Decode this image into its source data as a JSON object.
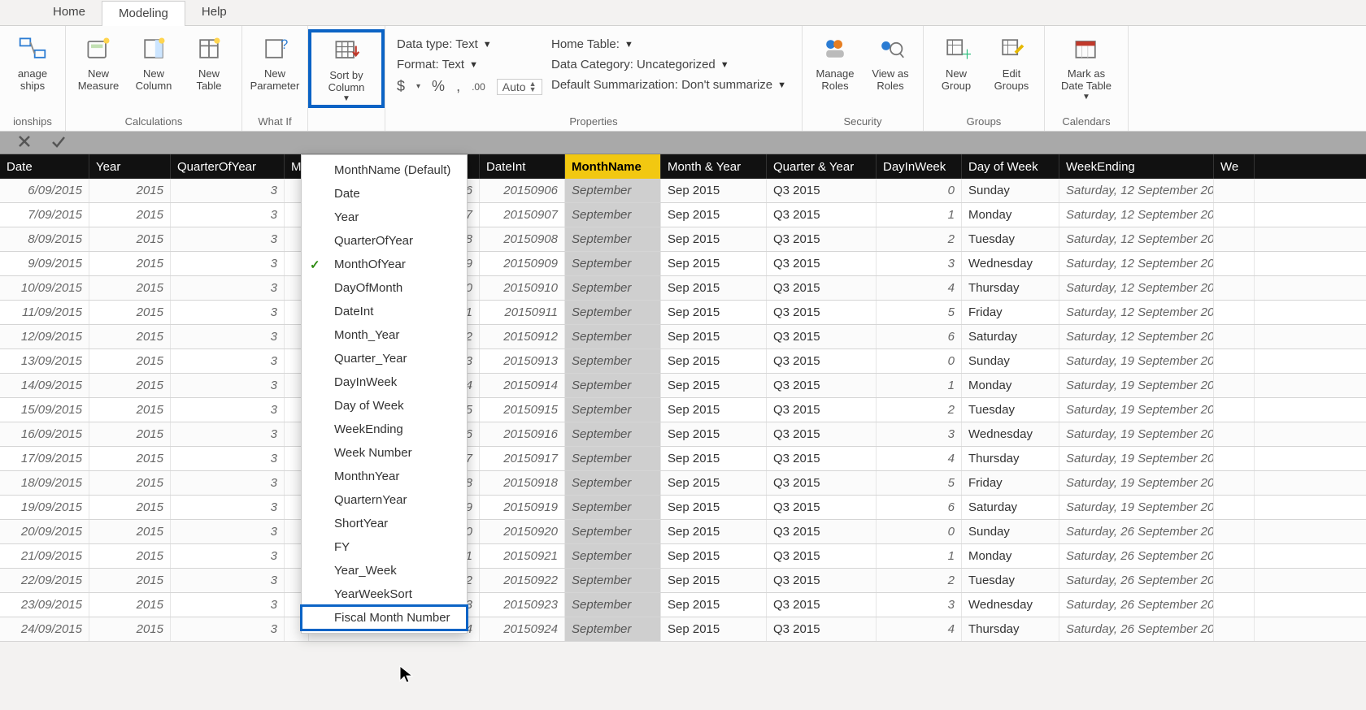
{
  "tabs": {
    "home": "Home",
    "modeling": "Modeling",
    "help": "Help"
  },
  "ribbon": {
    "manage_relationships": "anage\nships",
    "new_measure": "New\nMeasure",
    "new_column": "New\nColumn",
    "new_table": "New\nTable",
    "new_parameter": "New\nParameter",
    "sort_by_column": "Sort by\nColumn",
    "manage_roles": "Manage\nRoles",
    "view_as_roles": "View as\nRoles",
    "new_group": "New\nGroup",
    "edit_groups": "Edit\nGroups",
    "mark_as_date_table": "Mark as\nDate Table",
    "groups": {
      "relationships": "ionships",
      "calculations": "Calculations",
      "whatif": "What If",
      "sort": "",
      "properties": "Properties",
      "security": "Security",
      "groups_lbl": "Groups",
      "calendars": "Calendars"
    },
    "props": {
      "data_type": "Data type: Text",
      "home_table": "Home Table:",
      "format": "Format: Text",
      "data_category": "Data Category: Uncategorized",
      "default_summarization": "Default Summarization: Don't summarize",
      "dollar": "$",
      "percent": "%",
      "comma": ",",
      "decimals": ".00",
      "auto": "Auto"
    }
  },
  "dropdown": {
    "items": [
      {
        "label": "MonthName (Default)"
      },
      {
        "label": "Date"
      },
      {
        "label": "Year"
      },
      {
        "label": "QuarterOfYear"
      },
      {
        "label": "MonthOfYear",
        "checked": true
      },
      {
        "label": "DayOfMonth"
      },
      {
        "label": "DateInt"
      },
      {
        "label": "Month_Year"
      },
      {
        "label": "Quarter_Year"
      },
      {
        "label": "DayInWeek"
      },
      {
        "label": "Day of Week"
      },
      {
        "label": "WeekEnding"
      },
      {
        "label": "Week Number"
      },
      {
        "label": "MonthnYear"
      },
      {
        "label": "QuarternYear"
      },
      {
        "label": "ShortYear"
      },
      {
        "label": "FY"
      },
      {
        "label": "Year_Week"
      },
      {
        "label": "YearWeekSort"
      },
      {
        "label": "Fiscal Month Number",
        "highlight": true
      }
    ]
  },
  "grid": {
    "headers": {
      "date": "Date",
      "year": "Year",
      "qoy": "QuarterOfYear",
      "moy": "M",
      "hidden": "",
      "dateint": "DateInt",
      "monthname": "MonthName",
      "monthyear": "Month & Year",
      "quarteryear": "Quarter & Year",
      "dayinweek": "DayInWeek",
      "dayofweek": "Day of Week",
      "weekending": "WeekEnding",
      "wk": "We"
    },
    "rows": [
      {
        "date": "6/09/2015",
        "year": "2015",
        "qoy": "3",
        "pk": "6",
        "dateint": "20150906",
        "mname": "September",
        "my": "Sep 2015",
        "qy": "Q3 2015",
        "diw": "0",
        "dow": "Sunday",
        "wend": "Saturday, 12 September 20"
      },
      {
        "date": "7/09/2015",
        "year": "2015",
        "qoy": "3",
        "pk": "7",
        "dateint": "20150907",
        "mname": "September",
        "my": "Sep 2015",
        "qy": "Q3 2015",
        "diw": "1",
        "dow": "Monday",
        "wend": "Saturday, 12 September 20"
      },
      {
        "date": "8/09/2015",
        "year": "2015",
        "qoy": "3",
        "pk": "8",
        "dateint": "20150908",
        "mname": "September",
        "my": "Sep 2015",
        "qy": "Q3 2015",
        "diw": "2",
        "dow": "Tuesday",
        "wend": "Saturday, 12 September 20"
      },
      {
        "date": "9/09/2015",
        "year": "2015",
        "qoy": "3",
        "pk": "9",
        "dateint": "20150909",
        "mname": "September",
        "my": "Sep 2015",
        "qy": "Q3 2015",
        "diw": "3",
        "dow": "Wednesday",
        "wend": "Saturday, 12 September 20"
      },
      {
        "date": "10/09/2015",
        "year": "2015",
        "qoy": "3",
        "pk": "0",
        "dateint": "20150910",
        "mname": "September",
        "my": "Sep 2015",
        "qy": "Q3 2015",
        "diw": "4",
        "dow": "Thursday",
        "wend": "Saturday, 12 September 20"
      },
      {
        "date": "11/09/2015",
        "year": "2015",
        "qoy": "3",
        "pk": "1",
        "dateint": "20150911",
        "mname": "September",
        "my": "Sep 2015",
        "qy": "Q3 2015",
        "diw": "5",
        "dow": "Friday",
        "wend": "Saturday, 12 September 20"
      },
      {
        "date": "12/09/2015",
        "year": "2015",
        "qoy": "3",
        "pk": "2",
        "dateint": "20150912",
        "mname": "September",
        "my": "Sep 2015",
        "qy": "Q3 2015",
        "diw": "6",
        "dow": "Saturday",
        "wend": "Saturday, 12 September 20"
      },
      {
        "date": "13/09/2015",
        "year": "2015",
        "qoy": "3",
        "pk": "3",
        "dateint": "20150913",
        "mname": "September",
        "my": "Sep 2015",
        "qy": "Q3 2015",
        "diw": "0",
        "dow": "Sunday",
        "wend": "Saturday, 19 September 20"
      },
      {
        "date": "14/09/2015",
        "year": "2015",
        "qoy": "3",
        "pk": "4",
        "dateint": "20150914",
        "mname": "September",
        "my": "Sep 2015",
        "qy": "Q3 2015",
        "diw": "1",
        "dow": "Monday",
        "wend": "Saturday, 19 September 20"
      },
      {
        "date": "15/09/2015",
        "year": "2015",
        "qoy": "3",
        "pk": "5",
        "dateint": "20150915",
        "mname": "September",
        "my": "Sep 2015",
        "qy": "Q3 2015",
        "diw": "2",
        "dow": "Tuesday",
        "wend": "Saturday, 19 September 20"
      },
      {
        "date": "16/09/2015",
        "year": "2015",
        "qoy": "3",
        "pk": "6",
        "dateint": "20150916",
        "mname": "September",
        "my": "Sep 2015",
        "qy": "Q3 2015",
        "diw": "3",
        "dow": "Wednesday",
        "wend": "Saturday, 19 September 20"
      },
      {
        "date": "17/09/2015",
        "year": "2015",
        "qoy": "3",
        "pk": "7",
        "dateint": "20150917",
        "mname": "September",
        "my": "Sep 2015",
        "qy": "Q3 2015",
        "diw": "4",
        "dow": "Thursday",
        "wend": "Saturday, 19 September 20"
      },
      {
        "date": "18/09/2015",
        "year": "2015",
        "qoy": "3",
        "pk": "8",
        "dateint": "20150918",
        "mname": "September",
        "my": "Sep 2015",
        "qy": "Q3 2015",
        "diw": "5",
        "dow": "Friday",
        "wend": "Saturday, 19 September 20"
      },
      {
        "date": "19/09/2015",
        "year": "2015",
        "qoy": "3",
        "pk": "9",
        "dateint": "20150919",
        "mname": "September",
        "my": "Sep 2015",
        "qy": "Q3 2015",
        "diw": "6",
        "dow": "Saturday",
        "wend": "Saturday, 19 September 20"
      },
      {
        "date": "20/09/2015",
        "year": "2015",
        "qoy": "3",
        "pk": "0",
        "dateint": "20150920",
        "mname": "September",
        "my": "Sep 2015",
        "qy": "Q3 2015",
        "diw": "0",
        "dow": "Sunday",
        "wend": "Saturday, 26 September 20"
      },
      {
        "date": "21/09/2015",
        "year": "2015",
        "qoy": "3",
        "pk": "1",
        "dateint": "20150921",
        "mname": "September",
        "my": "Sep 2015",
        "qy": "Q3 2015",
        "diw": "1",
        "dow": "Monday",
        "wend": "Saturday, 26 September 20"
      },
      {
        "date": "22/09/2015",
        "year": "2015",
        "qoy": "3",
        "pk": "2",
        "dateint": "20150922",
        "mname": "September",
        "my": "Sep 2015",
        "qy": "Q3 2015",
        "diw": "2",
        "dow": "Tuesday",
        "wend": "Saturday, 26 September 20"
      },
      {
        "date": "23/09/2015",
        "year": "2015",
        "qoy": "3",
        "pk": "3",
        "dateint": "20150923",
        "mname": "September",
        "my": "Sep 2015",
        "qy": "Q3 2015",
        "diw": "3",
        "dow": "Wednesday",
        "wend": "Saturday, 26 September 20"
      },
      {
        "date": "24/09/2015",
        "year": "2015",
        "qoy": "3",
        "pk": "4",
        "dateint": "20150924",
        "mname": "September",
        "my": "Sep 2015",
        "qy": "Q3 2015",
        "diw": "4",
        "dow": "Thursday",
        "wend": "Saturday, 26 September 20"
      }
    ]
  }
}
